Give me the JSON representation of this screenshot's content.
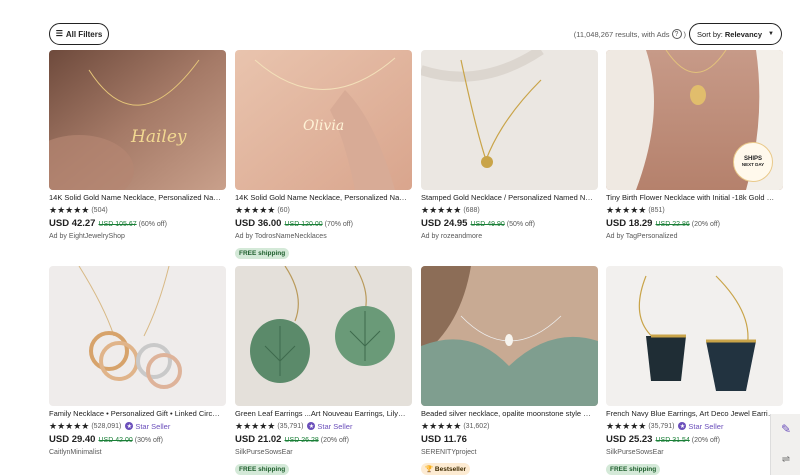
{
  "toolbar": {
    "filters_label": "All Filters",
    "results_text": "(11,048,267 results, with Ads",
    "results_close": ")",
    "help_icon": "?",
    "sort_prefix": "Sort by:",
    "sort_value": "Relevancy"
  },
  "products": [
    {
      "title": "14K Solid Gold Name Necklace, Personalized Name Necklace",
      "stars": "★★★★★",
      "rating": 4.5,
      "count": "(504)",
      "price": "USD 42.27",
      "original": "USD 105.67",
      "discount": "(60% off)",
      "shop": "Ad by EightJewelryShop",
      "star_seller": "",
      "tag": "",
      "thumb_text": "Hailey"
    },
    {
      "title": "14K Solid Gold Name Necklace, Personalized Name Necklace",
      "stars": "★★★★★",
      "rating": 4.5,
      "count": "(60)",
      "price": "USD 36.00",
      "original": "USD 120.00",
      "discount": "(70% off)",
      "shop": "Ad by TodrosNameNecklaces",
      "star_seller": "",
      "tag": "FREE shipping",
      "thumb_text": "Olivia"
    },
    {
      "title": "Stamped Gold Necklace / Personalized Named Necklace",
      "stars": "★★★★★",
      "rating": 4.5,
      "count": "(688)",
      "price": "USD 24.95",
      "original": "USD 49.90",
      "discount": "(50% off)",
      "shop": "Ad by rozeandmore",
      "star_seller": "",
      "tag": "",
      "thumb_text": ""
    },
    {
      "title": "Tiny Birth Flower Necklace with Initial -18k Gold Plated",
      "stars": "★★★★★",
      "rating": 4.5,
      "count": "(851)",
      "price": "USD 18.29",
      "original": "USD 22.86",
      "discount": "(20% off)",
      "shop": "Ad by TagPersonalized",
      "star_seller": "",
      "tag": "",
      "thumb_text": ""
    },
    {
      "title": "Family Necklace • Personalized Gift • Linked Circle Necklace",
      "stars": "★★★★★",
      "rating": 5,
      "count": "(528,091)",
      "price": "USD 29.40",
      "original": "USD 42.00",
      "discount": "(30% off)",
      "shop": "CaitlynMinimalist",
      "star_seller": "Star Seller",
      "tag": "",
      "thumb_text": ""
    },
    {
      "title": "Green Leaf Earrings ...Art Nouveau Earrings, Lily Pad Earrings",
      "stars": "★★★★★",
      "rating": 5,
      "count": "(35,791)",
      "price": "USD 21.02",
      "original": "USD 26.28",
      "discount": "(20% off)",
      "shop": "SilkPurseSowsEar",
      "star_seller": "Star Seller",
      "tag": "FREE shipping",
      "thumb_text": ""
    },
    {
      "title": "Beaded silver necklace, opalite moonstone style necklace",
      "stars": "★★★★★",
      "rating": 4.5,
      "count": "(31,602)",
      "price": "USD 11.76",
      "original": "",
      "discount": "",
      "shop": "SERENITYproject",
      "star_seller": "",
      "tag": "Bestseller",
      "thumb_text": ""
    },
    {
      "title": "French Navy Blue Earrings, Art Deco Jewel Earrings",
      "stars": "★★★★★",
      "rating": 5,
      "count": "(35,791)",
      "price": "USD 25.23",
      "original": "USD 31.54",
      "discount": "(20% off)",
      "shop": "SilkPurseSowsEar",
      "star_seller": "Star Seller",
      "tag": "FREE shipping",
      "thumb_text": ""
    }
  ],
  "badges": {
    "ships_line1": "SHIPS",
    "ships_line2": "NEXT DAY"
  },
  "side_tools": {
    "pen_icon": "pen-icon",
    "translate_icon": "translate-icon"
  },
  "colors": {
    "accent": "#6b4fbb",
    "sale_green": "#1a7f37",
    "free_shipping_bg": "#d4e9d8",
    "bestseller_bg": "#fdebd2"
  }
}
